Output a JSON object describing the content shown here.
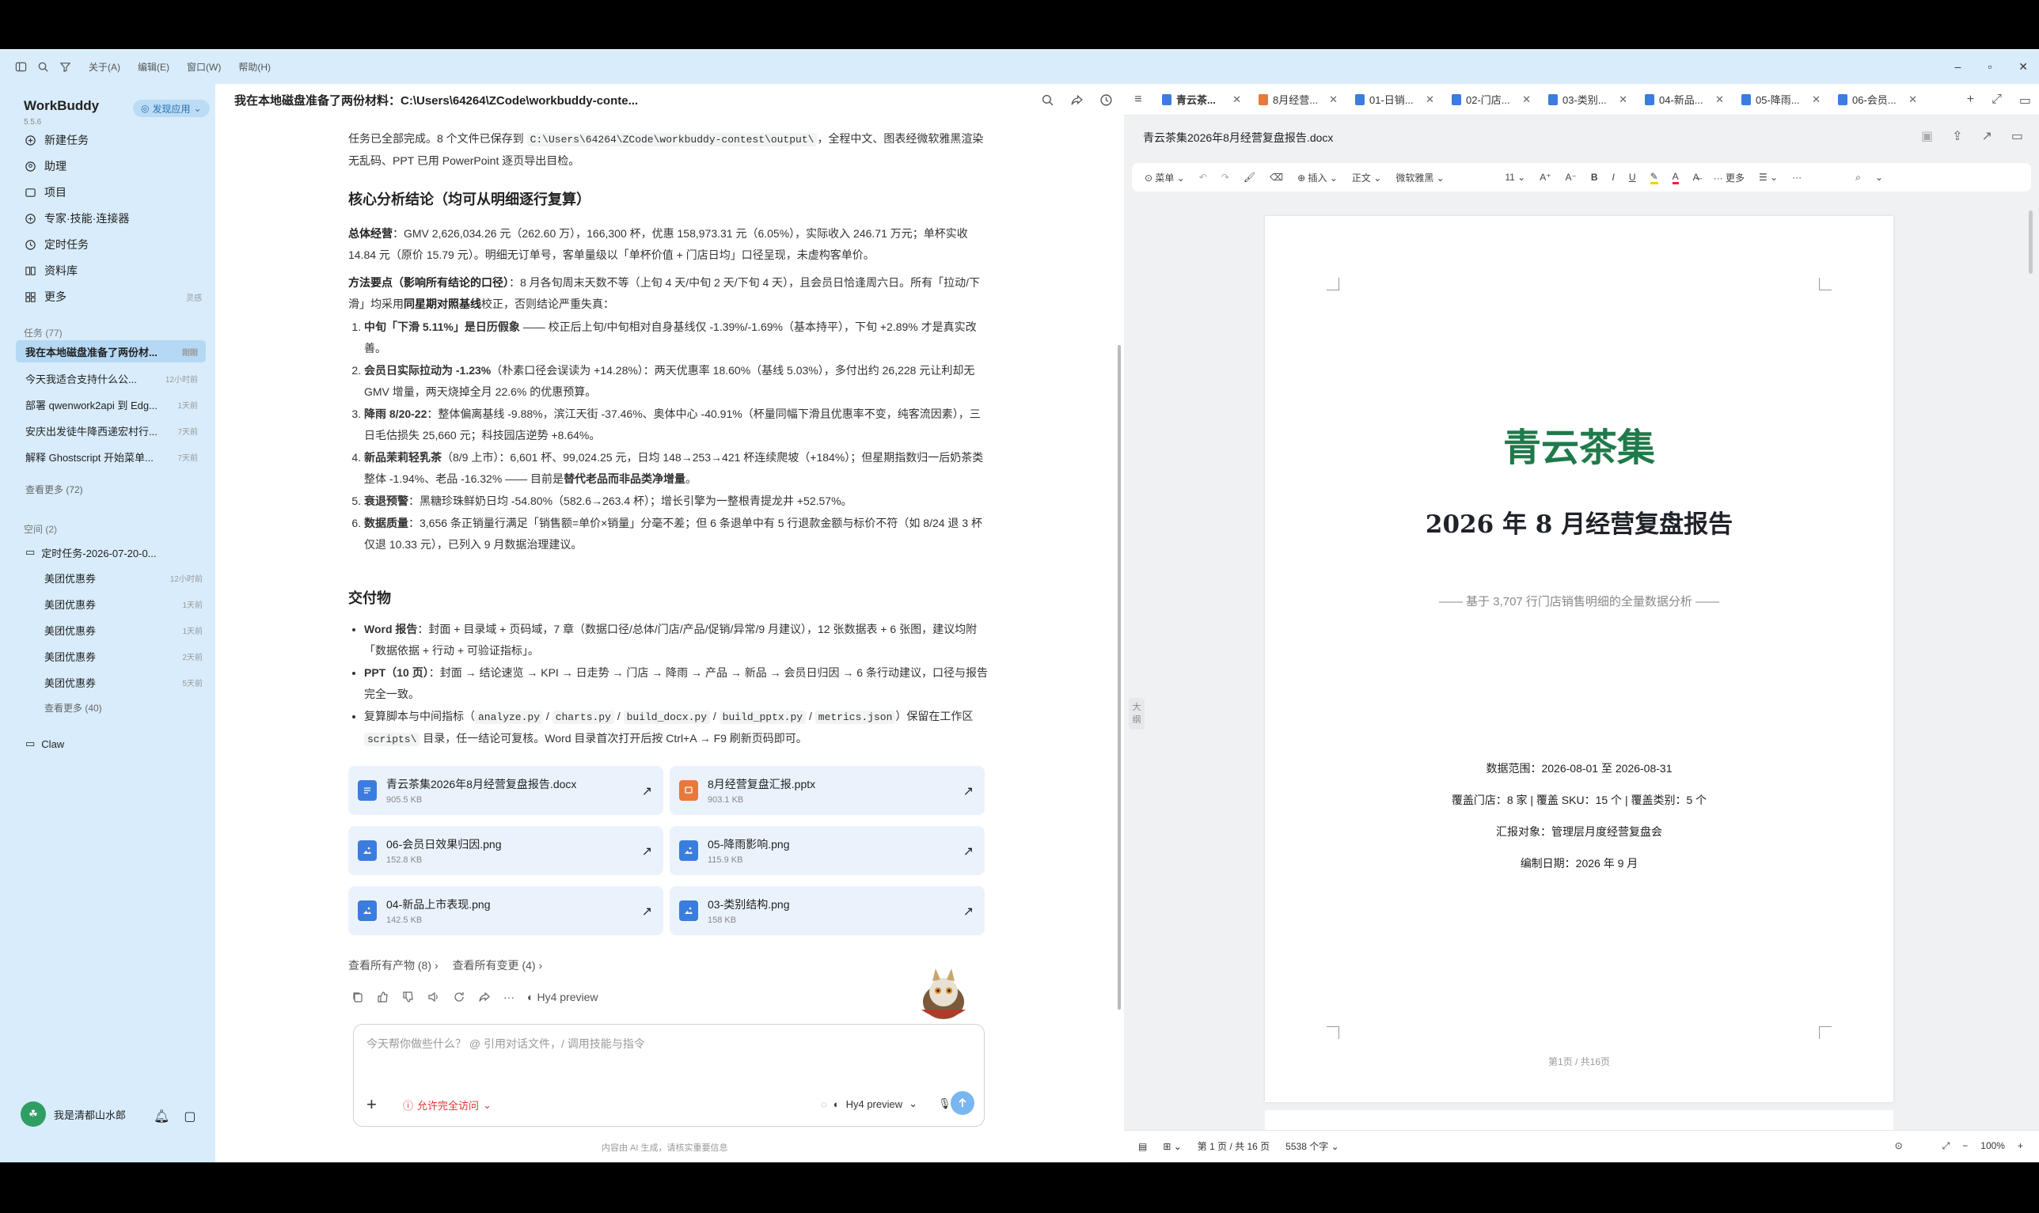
{
  "menubar": {
    "menus": [
      "关于(A)",
      "编辑(E)",
      "窗口(W)",
      "帮助(H)"
    ]
  },
  "sidebar": {
    "brand": "WorkBuddy",
    "version": "5.5.6",
    "discover": "发现应用",
    "nav": [
      {
        "label": "新建任务",
        "icon": "new-task-icon"
      },
      {
        "label": "助理",
        "icon": "assistant-icon"
      },
      {
        "label": "项目",
        "icon": "project-icon"
      },
      {
        "label": "专家·技能·连接器",
        "icon": "expert-icon"
      },
      {
        "label": "定时任务",
        "icon": "clock-icon"
      },
      {
        "label": "资料库",
        "icon": "library-icon"
      },
      {
        "label": "更多",
        "icon": "more-icon",
        "tag": "灵感"
      }
    ],
    "tasks_header": "任务 (77)",
    "tasks": [
      {
        "title": "我在本地磁盘准备了两份材...",
        "time": "刚刚"
      },
      {
        "title": "今天我适合支持什么公...",
        "time": "12小时前"
      },
      {
        "title": "部署 qwenwork2api 到 Edg...",
        "time": "1天前"
      },
      {
        "title": "安庆出发徒牛降西递宏村行...",
        "time": "7天前"
      },
      {
        "title": "解释 Ghostscript 开始菜单...",
        "time": "7天前"
      }
    ],
    "tasks_more": "查看更多 (72)",
    "spaces_header": "空间 (2)",
    "space_name": "定时任务-2026-07-20-0...",
    "space_items": [
      {
        "title": "美团优惠券",
        "time": "12小时前"
      },
      {
        "title": "美团优惠券",
        "time": "1天前"
      },
      {
        "title": "美团优惠券",
        "time": "1天前"
      },
      {
        "title": "美团优惠券",
        "time": "2天前"
      },
      {
        "title": "美团优惠券",
        "time": "5天前"
      }
    ],
    "space_more": "查看更多 (40)",
    "claw": "Claw",
    "user": "我是清都山水郎"
  },
  "chat": {
    "title": "我在本地磁盘准备了两份材料：C:\\Users\\64264\\ZCode\\workbuddy-conte...",
    "intro_a": "任务已全部完成。8 个文件已保存到 ",
    "intro_path": "C:\\Users\\64264\\ZCode\\workbuddy-contest\\output\\",
    "intro_b": "，全程中文、图表经微软雅黑渲染无乱码、PPT 已用 PowerPoint 逐页导出目检。",
    "h1": "核心分析结论（均可从明细逐行复算）",
    "overall_label": "总体经营",
    "overall_text": "：GMV 2,626,034.26 元（262.60 万），166,300 杯，优惠 158,973.31 元（6.05%），实际收入 246.71 万元；单杯实收 14.84 元（原价 15.79 元）。明细无订单号，客单量级以「单杯价值 + 门店日均」口径呈现，未虚构客单价。",
    "method_label": "方法要点（影响所有结论的口径）",
    "method_text": "：8 月各旬周末天数不等（上旬 4 天/中旬 2 天/下旬 4 天），且会员日恰逢周六日。所有「拉动/下滑」均采用",
    "method_bold": "同星期对照基线",
    "method_text2": "校正，否则结论严重失真：",
    "findings": [
      {
        "label": "中旬「下滑 5.11%」是日历假象",
        "text": " —— 校正后上旬/中旬相对自身基线仅 -1.39%/-1.69%（基本持平），下旬 +2.89% 才是真实改善。"
      },
      {
        "label": "会员日实际拉动为 -1.23%",
        "text": "（朴素口径会误读为 +14.28%）：两天优惠率 18.60%（基线 5.03%），多付出约 26,228 元让利却无 GMV 增量，两天烧掉全月 22.6% 的优惠预算。"
      },
      {
        "label": "降雨 8/20-22",
        "text": "：整体偏离基线 -9.88%，滨江天街 -37.46%、奥体中心 -40.91%（杯量同幅下滑且优惠率不变，纯客流因素），三日毛估损失 25,660 元；科技园店逆势 +8.64%。"
      },
      {
        "label": "新品茉莉轻乳茶",
        "text": "（8/9 上市）：6,601 杯、99,024.25 元，日均 148→253→421 杯连续爬坡（+184%）；但星期指数归一后奶茶类整体 -1.94%、老品 -16.32% —— 目前是",
        "bold2": "替代老品而非品类净增量",
        "tail": "。"
      },
      {
        "label": "衰退预警",
        "text": "：黑糖珍珠鲜奶日均 -54.80%（582.6→263.4 杯）；增长引擎为一整根青提龙井 +52.57%。"
      },
      {
        "label": "数据质量",
        "text": "：3,656 条正销量行满足「销售额=单价×销量」分毫不差；但 6 条退单中有 5 行退款金额与标价不符（如 8/24 退 3 杯仅退 10.33 元），已列入 9 月数据治理建议。"
      }
    ],
    "h2": "交付物",
    "deliverables": [
      {
        "label": "Word 报告",
        "text": "：封面 + 目录域 + 页码域，7 章（数据口径/总体/门店/产品/促销/异常/9 月建议），12 张数据表 + 6 张图，建议均附「数据依据 + 行动 + 可验证指标」。"
      },
      {
        "label": "PPT（10 页）",
        "text": "：封面 → 结论速览 → KPI → 日走势 → 门店 → 降雨 → 产品 → 新品 → 会员日归因 → 6 条行动建议，口径与报告完全一致。"
      },
      {
        "label": "",
        "text": "复算脚本与中间指标（",
        "c1": "analyze.py",
        "c2": "charts.py",
        "c3": "build_docx.py",
        "c4": "build_pptx.py",
        "c5": "metrics.json",
        "mid": "）保留在工作区 ",
        "c6": "scripts\\",
        "tail": " 目录，任一结论可复核。Word 目录首次打开后按 Ctrl+A → F9 刷新页码即可。"
      }
    ],
    "files": [
      {
        "name": "青云茶集2026年8月经营复盘报告.docx",
        "size": "905.5 KB",
        "kind": "doc",
        "color": "#3b7ddd"
      },
      {
        "name": "8月经营复盘汇报.pptx",
        "size": "903.1 KB",
        "kind": "ppt",
        "color": "#e8793a"
      },
      {
        "name": "06-会员日效果归因.png",
        "size": "152.8 KB",
        "kind": "img",
        "color": "#3b7ddd"
      },
      {
        "name": "05-降雨影响.png",
        "size": "115.9 KB",
        "kind": "img",
        "color": "#3b7ddd"
      },
      {
        "name": "04-新品上市表现.png",
        "size": "142.5 KB",
        "kind": "img",
        "color": "#3b7ddd"
      },
      {
        "name": "03-类别结构.png",
        "size": "158 KB",
        "kind": "img",
        "color": "#3b7ddd"
      }
    ],
    "all_artifacts": "查看所有产物 (8)",
    "all_changes": "查看所有变更 (4)",
    "model_tag": "Hy4 preview",
    "input_placeholder": "今天帮你做些什么？ @ 引用对话文件，/ 调用技能与指令",
    "access": "允许完全访问",
    "model_select": "Hy4 preview",
    "disclaimer": "内容由 AI 生成，请核实重要信息"
  },
  "doc": {
    "tabs": [
      {
        "label": "青云茶...",
        "color": "#3b7ddd",
        "active": true
      },
      {
        "label": "8月经营...",
        "color": "#e8793a",
        "active": false
      },
      {
        "label": "01-日销...",
        "color": "#3b7ddd",
        "active": false
      },
      {
        "label": "02-门店...",
        "color": "#3b7ddd",
        "active": false
      },
      {
        "label": "03-类别...",
        "color": "#3b7ddd",
        "active": false
      },
      {
        "label": "04-新品...",
        "color": "#3b7ddd",
        "active": false
      },
      {
        "label": "05-降雨...",
        "color": "#3b7ddd",
        "active": false
      },
      {
        "label": "06-会员...",
        "color": "#3b7ddd",
        "active": false
      }
    ],
    "file_name": "青云茶集2026年8月经营复盘报告.docx",
    "toolbar": {
      "menu": "菜单",
      "insert": "插入",
      "style": "正文",
      "font": "微软雅黑",
      "size": "11",
      "more": "更多"
    },
    "page": {
      "title": "青云茶集",
      "subtitle": "2026 年 8 月经营复盘报告",
      "tagline": "—— 基于 3,707 行门店销售明细的全量数据分析 ——",
      "meta1": "数据范围：2026-08-01 至 2026-08-31",
      "meta2": "覆盖门店：8 家  |  覆盖 SKU：15 个  |  覆盖类别：5 个",
      "meta3": "汇报对象：管理层月度经营复盘会",
      "meta4": "编制日期：2026 年 9 月",
      "page_no": "第1页 / 共16页"
    },
    "outline": "大纲",
    "status": {
      "pages": "第 1 页 / 共 16 页",
      "words": "5538 个字",
      "zoom": "100%"
    }
  }
}
